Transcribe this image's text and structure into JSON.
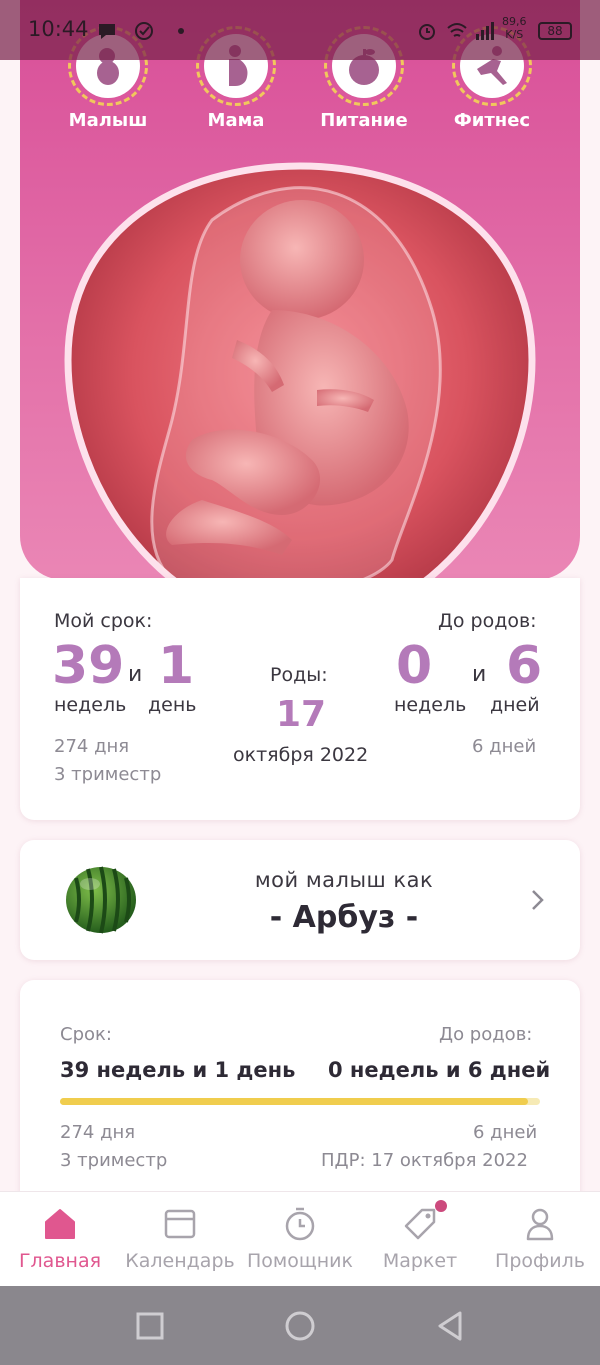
{
  "status_bar": {
    "time": "10:44",
    "net_speed_value": "89,6",
    "net_speed_unit": "K/S",
    "battery": "88"
  },
  "categories": [
    {
      "label": "Малыш",
      "icon": "baby-icon"
    },
    {
      "label": "Мама",
      "icon": "pregnant-mom-icon"
    },
    {
      "label": "Питание",
      "icon": "apple-icon"
    },
    {
      "label": "Фитнес",
      "icon": "fitness-icon"
    }
  ],
  "term_card": {
    "my_term_label": "Мой срок:",
    "weeks": "39",
    "and": "и",
    "days": "1",
    "weeks_word": "недель",
    "days_word": "день",
    "days_total": "274 дня",
    "trimester": "3 триместр",
    "birth_label": "Роды:",
    "birth_day": "17",
    "birth_month_year": "октября 2022",
    "until_birth_label": "До родов:",
    "left_weeks": "0",
    "left_and": "и",
    "left_days": "6",
    "left_weeks_word": "недель",
    "left_days_word": "дней",
    "left_days_total": "6 дней"
  },
  "size_card": {
    "caption": "мой малыш как",
    "fruit": "- Арбуз -",
    "icon": "watermelon-icon"
  },
  "progress_card": {
    "term_label": "Срок:",
    "term_value": "39 недель и 1 день",
    "until_label": "До родов:",
    "until_value": "0 недель и 6 дней",
    "progress": 0.975,
    "days_total": "274 дня",
    "days_left": "6 дней",
    "trimester": "3 триместр",
    "due_date": "ПДР: 17 октября 2022"
  },
  "bottom_nav": [
    {
      "label": "Главная",
      "icon": "home-icon",
      "active": true
    },
    {
      "label": "Календарь",
      "icon": "calendar-icon",
      "active": false
    },
    {
      "label": "Помощник",
      "icon": "timer-icon",
      "active": false
    },
    {
      "label": "Маркет",
      "icon": "tag-icon",
      "active": false
    },
    {
      "label": "Профиль",
      "icon": "profile-icon",
      "active": false
    }
  ],
  "colors": {
    "accent": "#e0578f",
    "number_purple": "#b47ab9",
    "progress_yellow": "#f0cd4e",
    "hero_pink": "#d84e98"
  }
}
